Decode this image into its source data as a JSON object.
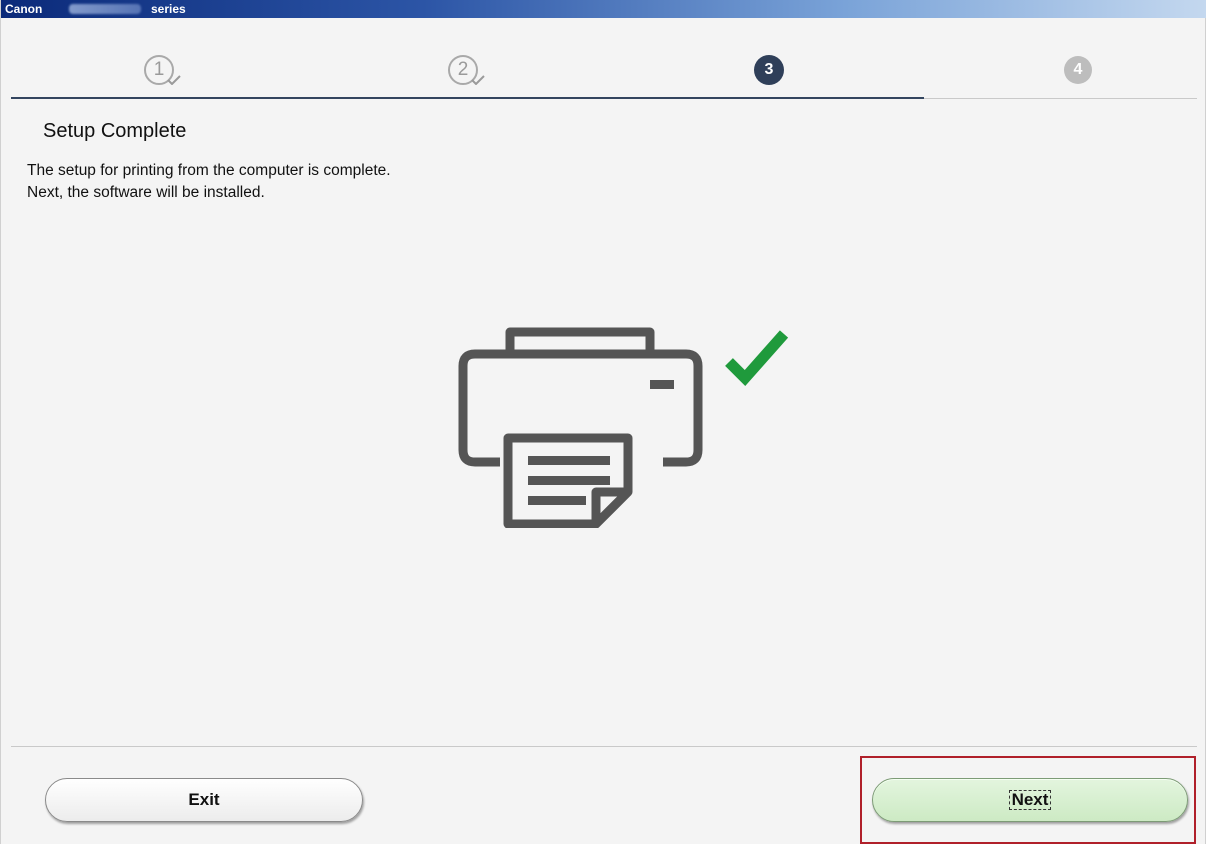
{
  "titlebar": {
    "brand": "Canon",
    "series": "series"
  },
  "steps": [
    {
      "label": "1",
      "state": "done"
    },
    {
      "label": "2",
      "state": "done"
    },
    {
      "label": "3",
      "state": "current"
    },
    {
      "label": "4",
      "state": "future"
    }
  ],
  "content": {
    "title": "Setup Complete",
    "line1": "The setup for printing from the computer is complete.",
    "line2": "Next, the software will be installed."
  },
  "illustration": {
    "icon": "printer-icon",
    "check_icon": "checkmark-icon",
    "check_color": "#1f9a3c"
  },
  "buttons": {
    "exit": "Exit",
    "next": "Next"
  },
  "colors": {
    "step_current": "#2f3f59",
    "next_button": "#d4efcc",
    "highlight": "#b0202a"
  }
}
